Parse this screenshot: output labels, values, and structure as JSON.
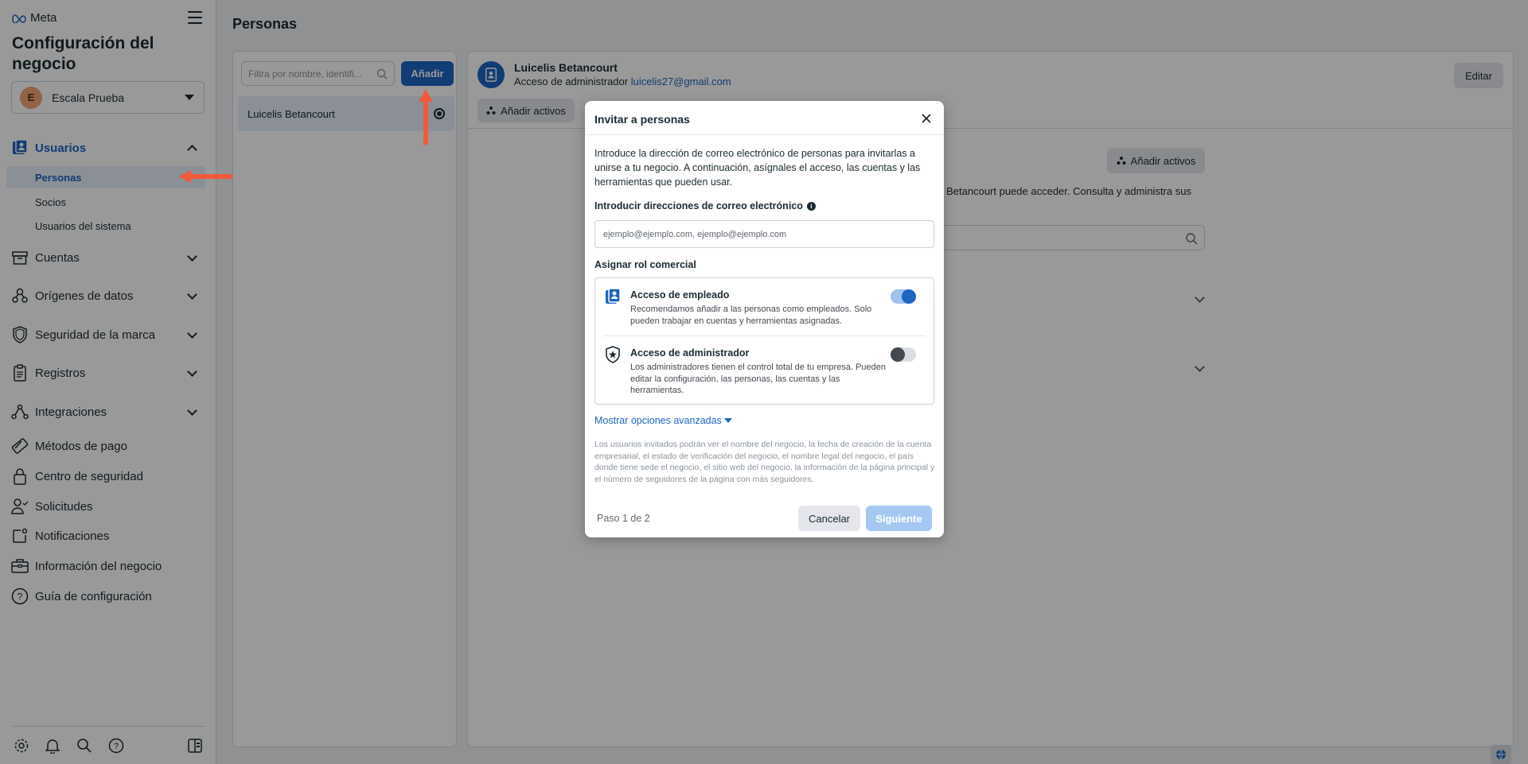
{
  "brand": {
    "logo_text": "Meta",
    "accent": "#1d65c1",
    "arrow_color": "#f05a3c"
  },
  "sidebar": {
    "title": "Configuración del negocio",
    "account": {
      "initial": "E",
      "name": "Escala Prueba"
    },
    "users_section": {
      "label": "Usuarios",
      "items": [
        {
          "label": "Personas",
          "selected": true
        },
        {
          "label": "Socios"
        },
        {
          "label": "Usuarios del sistema"
        }
      ]
    },
    "sections": [
      {
        "label": "Cuentas",
        "icon": "folder-icon"
      },
      {
        "label": "Orígenes de datos",
        "icon": "data-sources-icon"
      },
      {
        "label": "Seguridad de la marca",
        "icon": "shield-icon"
      },
      {
        "label": "Registros",
        "icon": "clipboard-icon"
      },
      {
        "label": "Integraciones",
        "icon": "integrations-icon"
      }
    ],
    "links": [
      {
        "label": "Métodos de pago",
        "icon": "payment-icon"
      },
      {
        "label": "Centro de seguridad",
        "icon": "lock-icon"
      },
      {
        "label": "Solicitudes",
        "icon": "person-check-icon"
      },
      {
        "label": "Notificaciones",
        "icon": "notification-icon"
      },
      {
        "label": "Información del negocio",
        "icon": "briefcase-icon"
      },
      {
        "label": "Guía de configuración",
        "icon": "help-icon"
      }
    ]
  },
  "page": {
    "title": "Personas"
  },
  "list": {
    "filter_placeholder": "Filtra por nombre, identifi...",
    "add_label": "Añadir",
    "people": [
      {
        "name": "Luicelis Betancourt"
      }
    ]
  },
  "detail": {
    "name": "Luicelis Betancourt",
    "access_prefix": "Acceso de administrador",
    "email": "luicelis27@gmail.com",
    "edit_label": "Editar",
    "assets_label": "Añadir activos",
    "assets_label_body": "Añadir activos",
    "description": "s Betancourt puede acceder. Consulta y administra sus"
  },
  "modal": {
    "title": "Invitar a personas",
    "intro": "Introduce la dirección de correo electrónico de personas para invitarlas a unirse a tu negocio. A continuación, asígnales el acceso, las cuentas y las herramientas que pueden usar.",
    "email_label": "Introducir direcciones de correo electrónico",
    "email_placeholder": "ejemplo@ejemplo.com, ejemplo@ejemplo.com",
    "role_label": "Asignar rol comercial",
    "roles": [
      {
        "name": "Acceso de empleado",
        "desc": "Recomendamos añadir a las personas como empleados. Solo pueden trabajar en cuentas y herramientas asignadas.",
        "enabled": true
      },
      {
        "name": "Acceso de administrador",
        "desc": "Los administradores tienen el control total de tu empresa. Pueden editar la configuración, las personas, las cuentas y las herramientas.",
        "enabled": false
      }
    ],
    "advanced_link": "Mostrar opciones avanzadas",
    "note": "Los usuarios invitados podrán ver el nombre del negocio, la fecha de creación de la cuenta empresarial, el estado de verificación del negocio, el nombre legal del negocio, el país donde tiene sede el negocio, el sitio web del negocio, la información de la página principal y el número de seguidores de la página con más seguidores.",
    "step": "Paso 1 de 2",
    "cancel_label": "Cancelar",
    "next_label": "Siguiente"
  }
}
